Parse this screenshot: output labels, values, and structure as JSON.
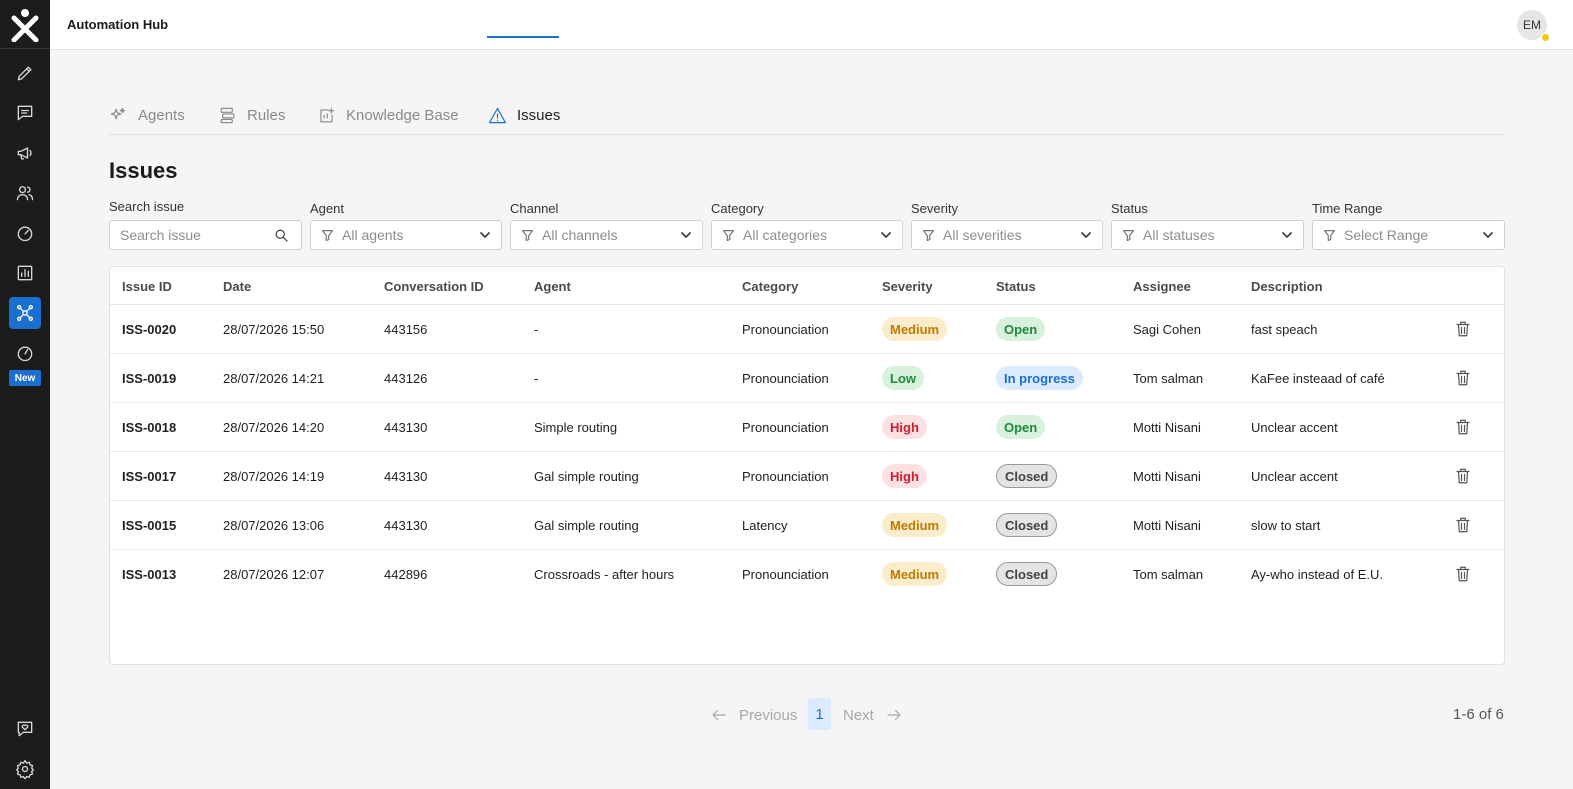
{
  "app": {
    "title": "Automation Hub",
    "user_initials": "EM"
  },
  "sidebar": {
    "items": [
      {
        "icon": "pencil-icon"
      },
      {
        "icon": "chat-icon"
      },
      {
        "icon": "megaphone-icon"
      },
      {
        "icon": "users-icon"
      },
      {
        "icon": "speedometer-icon"
      },
      {
        "icon": "bar-chart-icon"
      },
      {
        "icon": "automation-hub-icon",
        "active": true
      },
      {
        "icon": "gauge-icon"
      }
    ],
    "new_badge": "New",
    "bottom_items": [
      {
        "icon": "feedback-heart-icon"
      },
      {
        "icon": "gear-icon"
      }
    ]
  },
  "tabs": [
    {
      "label": "Agents",
      "icon": "sparkle-icon"
    },
    {
      "label": "Rules",
      "icon": "rules-icon"
    },
    {
      "label": "Knowledge Base",
      "icon": "knowledge-base-icon"
    },
    {
      "label": "Issues",
      "icon": "warning-icon",
      "active": true
    }
  ],
  "page_title": "Issues",
  "filters": {
    "search": {
      "label": "Search issue",
      "placeholder": "Search issue"
    },
    "agent": {
      "label": "Agent",
      "value": "All agents"
    },
    "channel": {
      "label": "Channel",
      "value": "All channels"
    },
    "category": {
      "label": "Category",
      "value": "All categories"
    },
    "severity": {
      "label": "Severity",
      "value": "All severities"
    },
    "status": {
      "label": "Status",
      "value": "All statuses"
    },
    "time_range": {
      "label": "Time Range",
      "value": "Select Range"
    }
  },
  "table": {
    "columns": [
      "Issue ID",
      "Date",
      "Conversation ID",
      "Agent",
      "Category",
      "Severity",
      "Status",
      "Assignee",
      "Description"
    ],
    "rows": [
      {
        "id": "ISS-0020",
        "date": "28/07/2026 15:50",
        "conversation": "443156",
        "agent": "-",
        "category": "Pronounciation",
        "severity": "Medium",
        "status": "Open",
        "assignee": "Sagi Cohen",
        "description": "fast speach"
      },
      {
        "id": "ISS-0019",
        "date": "28/07/2026 14:21",
        "conversation": "443126",
        "agent": "-",
        "category": "Pronounciation",
        "severity": "Low",
        "status": "In progress",
        "assignee": "Tom salman",
        "description": "KaFee insteaad of café"
      },
      {
        "id": "ISS-0018",
        "date": "28/07/2026 14:20",
        "conversation": "443130",
        "agent": "Simple routing",
        "category": "Pronounciation",
        "severity": "High",
        "status": "Open",
        "assignee": "Motti Nisani",
        "description": "Unclear accent"
      },
      {
        "id": "ISS-0017",
        "date": "28/07/2026 14:19",
        "conversation": "443130",
        "agent": "Gal simple routing",
        "category": "Pronounciation",
        "severity": "High",
        "status": "Closed",
        "assignee": "Motti Nisani",
        "description": "Unclear accent"
      },
      {
        "id": "ISS-0015",
        "date": "28/07/2026 13:06",
        "conversation": "443130",
        "agent": "Gal simple routing",
        "category": "Latency",
        "severity": "Medium",
        "status": "Closed",
        "assignee": "Motti Nisani",
        "description": "slow to start"
      },
      {
        "id": "ISS-0013",
        "date": "28/07/2026 12:07",
        "conversation": "442896",
        "agent": "Crossroads - after hours",
        "category": "Pronounciation",
        "severity": "Medium",
        "status": "Closed",
        "assignee": "Tom salman",
        "description": "Ay-who instead of E.U."
      }
    ]
  },
  "pagination": {
    "previous": "Previous",
    "current": "1",
    "next": "Next",
    "range": "1-6 of 6"
  },
  "colors": {
    "accent": "#1a6fd1",
    "sidebar_bg": "#1c1c1c",
    "page_bg": "#f5f5f5"
  }
}
